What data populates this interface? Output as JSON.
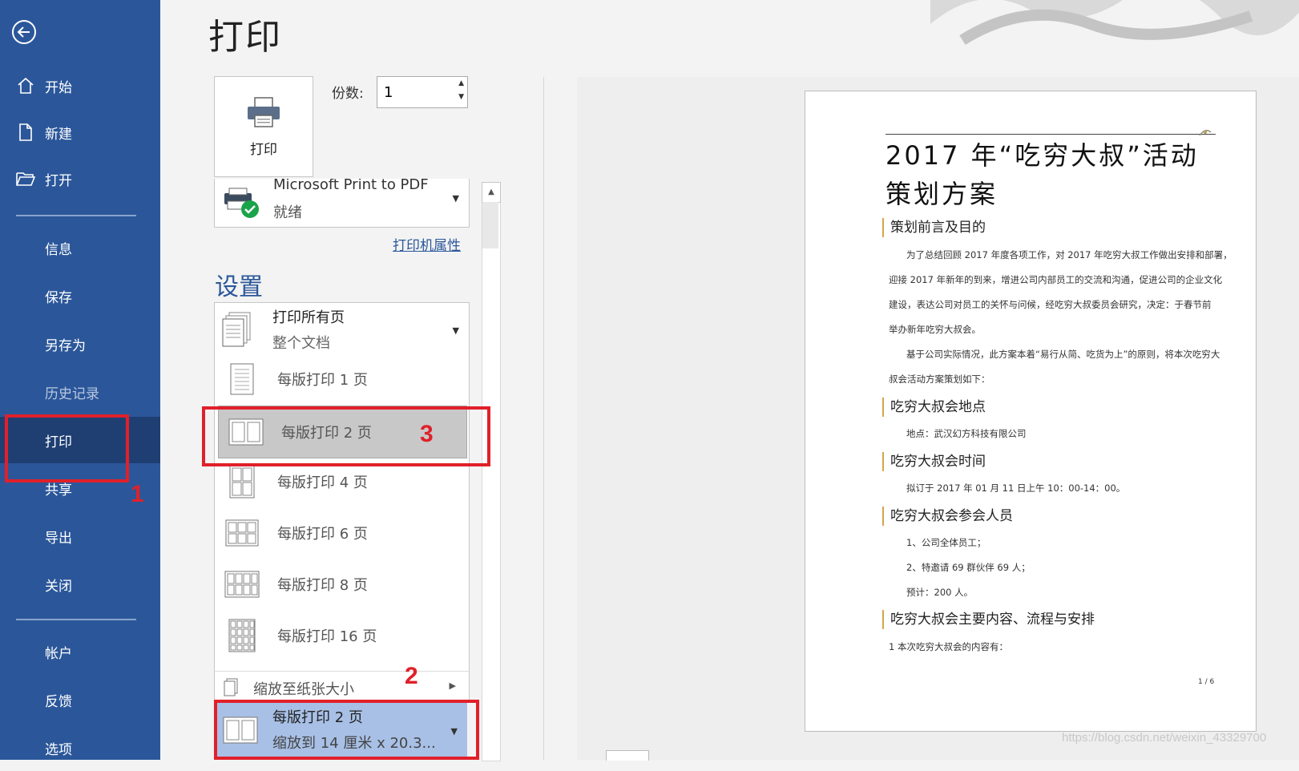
{
  "sidebar": {
    "items": [
      {
        "label": "开始",
        "icon": "home-icon"
      },
      {
        "label": "新建",
        "icon": "new-document-icon"
      },
      {
        "label": "打开",
        "icon": "open-folder-icon"
      },
      {
        "label": "信息"
      },
      {
        "label": "保存"
      },
      {
        "label": "另存为"
      },
      {
        "label": "历史记录"
      },
      {
        "label": "打印"
      },
      {
        "label": "共享"
      },
      {
        "label": "导出"
      },
      {
        "label": "关闭"
      },
      {
        "label": "帐户"
      },
      {
        "label": "反馈"
      },
      {
        "label": "选项"
      }
    ],
    "active": "打印",
    "bg_color": "#2b579a"
  },
  "header": {
    "title": "打印"
  },
  "print_panel": {
    "print_button_label": "打印",
    "copies_label": "份数:",
    "copies_value": "1",
    "printer": {
      "name": "Microsoft Print to PDF",
      "status": "就绪"
    },
    "printer_properties_label": "打印机属性",
    "settings_title": "设置",
    "range": {
      "main": "打印所有页",
      "sub": "整个文档"
    },
    "pages_per_sheet_options": [
      "每版打印 1 页",
      "每版打印 2 页",
      "每版打印 4 页",
      "每版打印 6 页",
      "每版打印 8 页",
      "每版打印 16 页"
    ],
    "scale_to_paper_label": "缩放至纸张大小",
    "selected": {
      "main": "每版打印 2 页",
      "sub": "缩放到 14 厘米 x 20.3..."
    }
  },
  "annotations": {
    "marker_1": "1",
    "marker_2": "2",
    "marker_3": "3",
    "color": "#e0202a"
  },
  "document": {
    "title_line1": "2017 年“吃穷大叔”活动",
    "title_line2": "策划方案",
    "sections": [
      {
        "heading": "策划前言及目的"
      },
      {
        "heading": "吃穷大叔会地点"
      },
      {
        "heading": "吃穷大叔会时间"
      },
      {
        "heading": "吃穷大叔会参会人员"
      },
      {
        "heading": "吃穷大叔会主要内容、流程与安排"
      }
    ],
    "para1": [
      "为了总结回顾 2017 年度各项工作，对 2017 年吃穷大叔工作做出安排和部署，",
      "迎接 2017 年新年的到来，增进公司内部员工的交流和沟通，促进公司的企业文化",
      "建设，表达公司对员工的关怀与问候，经吃穷大叔委员会研究，决定：于春节前",
      "举办新年吃穷大叔会。"
    ],
    "para2": [
      "基于公司实际情况，此方案本着“易行从简、吃货为上”的原则，将本次吃穷大",
      "叔会活动方案策划如下："
    ],
    "location": "地点：武汉幻方科技有限公司",
    "time": "拟订于 2017 年 01 月 11 日上午 10：00-14：00。",
    "people": [
      "1、公司全体员工；",
      "2、特邀请 69 群伙伴 69 人；",
      "预计：200 人。"
    ],
    "content_line": "1    本次吃穷大叔会的内容有：",
    "page_number": "1 / 6"
  },
  "watermark": "https://blog.csdn.net/weixin_43329700"
}
